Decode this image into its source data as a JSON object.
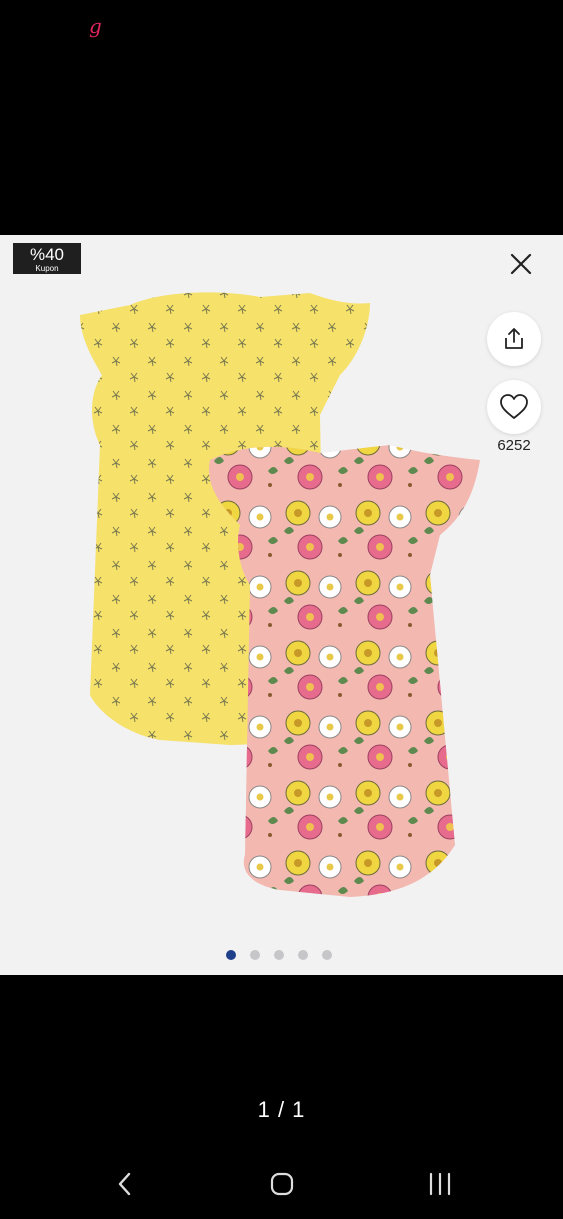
{
  "status_bar": {
    "app_icon": "g"
  },
  "coupon": {
    "percent": "%40",
    "label": "Kupon"
  },
  "actions": {
    "close_icon": "close-icon",
    "share_icon": "share-icon",
    "favorite_icon": "heart-icon",
    "favorite_count": "6252"
  },
  "gallery": {
    "total_images": 5,
    "active_index": 0
  },
  "page_counter": "1 / 1",
  "navigation": {
    "back": "chevron-left-icon",
    "home": "home-icon",
    "recents": "recents-icon"
  }
}
